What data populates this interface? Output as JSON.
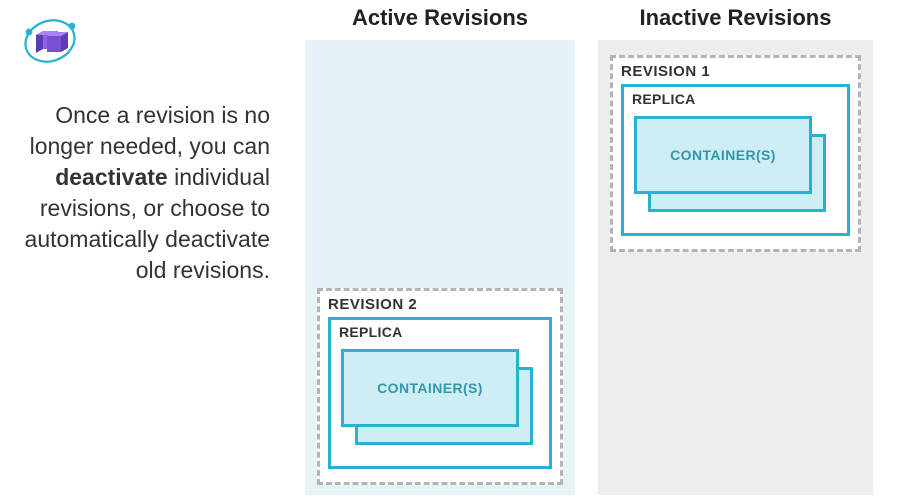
{
  "explain": {
    "lead": "Once a revision is no longer needed, you can ",
    "bold": "deactivate",
    "tail": " individual revisions, or choose to automatically deactivate old revisions."
  },
  "columns": {
    "active": {
      "title": "Active Revisions"
    },
    "inactive": {
      "title": "Inactive Revisions"
    }
  },
  "revision_active": {
    "label": "REVISION 2",
    "replica_label": "REPLICA",
    "container_label": "CONTAINER(S)"
  },
  "revision_inactive": {
    "label": "REVISION 1",
    "replica_label": "REPLICA",
    "container_label": "CONTAINER(S)"
  },
  "brand": {
    "purple": "#7b4fd1",
    "teal": "#27b3cf"
  }
}
